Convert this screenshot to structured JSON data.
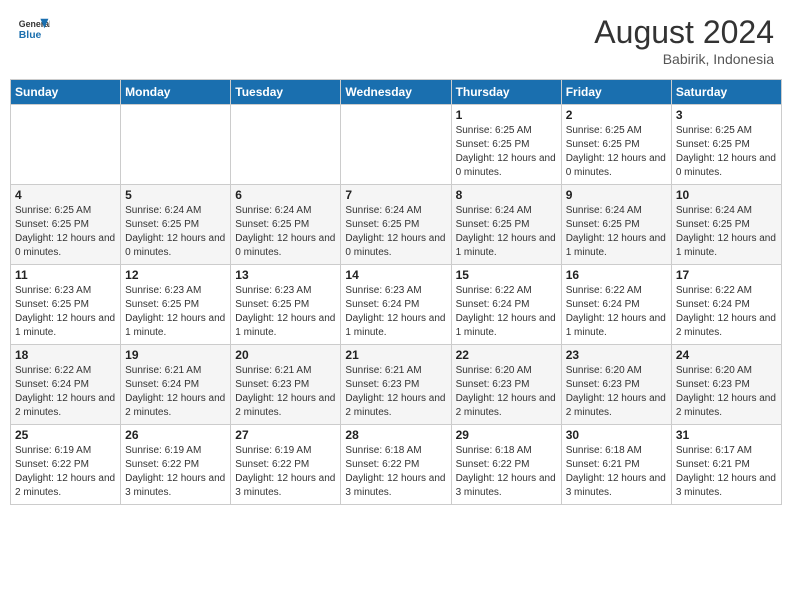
{
  "header": {
    "logo_line1": "General",
    "logo_line2": "Blue",
    "month_year": "August 2024",
    "location": "Babirik, Indonesia"
  },
  "weekdays": [
    "Sunday",
    "Monday",
    "Tuesday",
    "Wednesday",
    "Thursday",
    "Friday",
    "Saturday"
  ],
  "weeks": [
    [
      {
        "day": "",
        "info": ""
      },
      {
        "day": "",
        "info": ""
      },
      {
        "day": "",
        "info": ""
      },
      {
        "day": "",
        "info": ""
      },
      {
        "day": "1",
        "info": "Sunrise: 6:25 AM\nSunset: 6:25 PM\nDaylight: 12 hours\nand 0 minutes."
      },
      {
        "day": "2",
        "info": "Sunrise: 6:25 AM\nSunset: 6:25 PM\nDaylight: 12 hours\nand 0 minutes."
      },
      {
        "day": "3",
        "info": "Sunrise: 6:25 AM\nSunset: 6:25 PM\nDaylight: 12 hours\nand 0 minutes."
      }
    ],
    [
      {
        "day": "4",
        "info": "Sunrise: 6:25 AM\nSunset: 6:25 PM\nDaylight: 12 hours\nand 0 minutes."
      },
      {
        "day": "5",
        "info": "Sunrise: 6:24 AM\nSunset: 6:25 PM\nDaylight: 12 hours\nand 0 minutes."
      },
      {
        "day": "6",
        "info": "Sunrise: 6:24 AM\nSunset: 6:25 PM\nDaylight: 12 hours\nand 0 minutes."
      },
      {
        "day": "7",
        "info": "Sunrise: 6:24 AM\nSunset: 6:25 PM\nDaylight: 12 hours\nand 0 minutes."
      },
      {
        "day": "8",
        "info": "Sunrise: 6:24 AM\nSunset: 6:25 PM\nDaylight: 12 hours\nand 1 minute."
      },
      {
        "day": "9",
        "info": "Sunrise: 6:24 AM\nSunset: 6:25 PM\nDaylight: 12 hours\nand 1 minute."
      },
      {
        "day": "10",
        "info": "Sunrise: 6:24 AM\nSunset: 6:25 PM\nDaylight: 12 hours\nand 1 minute."
      }
    ],
    [
      {
        "day": "11",
        "info": "Sunrise: 6:23 AM\nSunset: 6:25 PM\nDaylight: 12 hours\nand 1 minute."
      },
      {
        "day": "12",
        "info": "Sunrise: 6:23 AM\nSunset: 6:25 PM\nDaylight: 12 hours\nand 1 minute."
      },
      {
        "day": "13",
        "info": "Sunrise: 6:23 AM\nSunset: 6:25 PM\nDaylight: 12 hours\nand 1 minute."
      },
      {
        "day": "14",
        "info": "Sunrise: 6:23 AM\nSunset: 6:24 PM\nDaylight: 12 hours\nand 1 minute."
      },
      {
        "day": "15",
        "info": "Sunrise: 6:22 AM\nSunset: 6:24 PM\nDaylight: 12 hours\nand 1 minute."
      },
      {
        "day": "16",
        "info": "Sunrise: 6:22 AM\nSunset: 6:24 PM\nDaylight: 12 hours\nand 1 minute."
      },
      {
        "day": "17",
        "info": "Sunrise: 6:22 AM\nSunset: 6:24 PM\nDaylight: 12 hours\nand 2 minutes."
      }
    ],
    [
      {
        "day": "18",
        "info": "Sunrise: 6:22 AM\nSunset: 6:24 PM\nDaylight: 12 hours\nand 2 minutes."
      },
      {
        "day": "19",
        "info": "Sunrise: 6:21 AM\nSunset: 6:24 PM\nDaylight: 12 hours\nand 2 minutes."
      },
      {
        "day": "20",
        "info": "Sunrise: 6:21 AM\nSunset: 6:23 PM\nDaylight: 12 hours\nand 2 minutes."
      },
      {
        "day": "21",
        "info": "Sunrise: 6:21 AM\nSunset: 6:23 PM\nDaylight: 12 hours\nand 2 minutes."
      },
      {
        "day": "22",
        "info": "Sunrise: 6:20 AM\nSunset: 6:23 PM\nDaylight: 12 hours\nand 2 minutes."
      },
      {
        "day": "23",
        "info": "Sunrise: 6:20 AM\nSunset: 6:23 PM\nDaylight: 12 hours\nand 2 minutes."
      },
      {
        "day": "24",
        "info": "Sunrise: 6:20 AM\nSunset: 6:23 PM\nDaylight: 12 hours\nand 2 minutes."
      }
    ],
    [
      {
        "day": "25",
        "info": "Sunrise: 6:19 AM\nSunset: 6:22 PM\nDaylight: 12 hours\nand 2 minutes."
      },
      {
        "day": "26",
        "info": "Sunrise: 6:19 AM\nSunset: 6:22 PM\nDaylight: 12 hours\nand 3 minutes."
      },
      {
        "day": "27",
        "info": "Sunrise: 6:19 AM\nSunset: 6:22 PM\nDaylight: 12 hours\nand 3 minutes."
      },
      {
        "day": "28",
        "info": "Sunrise: 6:18 AM\nSunset: 6:22 PM\nDaylight: 12 hours\nand 3 minutes."
      },
      {
        "day": "29",
        "info": "Sunrise: 6:18 AM\nSunset: 6:22 PM\nDaylight: 12 hours\nand 3 minutes."
      },
      {
        "day": "30",
        "info": "Sunrise: 6:18 AM\nSunset: 6:21 PM\nDaylight: 12 hours\nand 3 minutes."
      },
      {
        "day": "31",
        "info": "Sunrise: 6:17 AM\nSunset: 6:21 PM\nDaylight: 12 hours\nand 3 minutes."
      }
    ]
  ]
}
